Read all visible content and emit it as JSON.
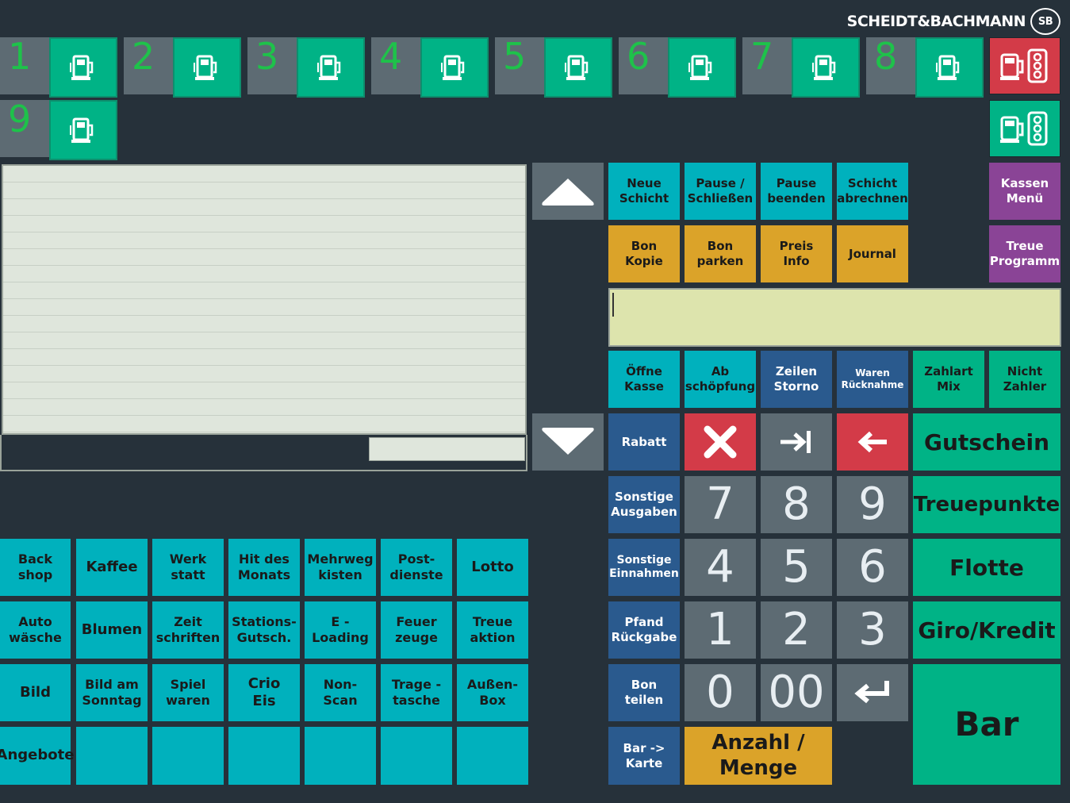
{
  "brand": {
    "name": "SCHEIDT&BACHMANN",
    "logo": "SB"
  },
  "pumps": [
    "1",
    "2",
    "3",
    "4",
    "5",
    "6",
    "7",
    "8",
    "9"
  ],
  "right_side": {
    "kassen_menu": "Kassen\nMenü",
    "treue_programm": "Treue\nProgramm"
  },
  "shift": {
    "neue_schicht": "Neue\nSchicht",
    "pause_schliessen": "Pause /\nSchließen",
    "pause_beenden": "Pause\nbeenden",
    "schicht_abrechnen": "Schicht\nabrechnen"
  },
  "receipt_ops": {
    "bon_kopie": "Bon\nKopie",
    "bon_parken": "Bon\nparken",
    "preis_info": "Preis\nInfo",
    "journal": "Journal"
  },
  "register": {
    "oeffne_kasse": "Öffne\nKasse",
    "abschoepfung": "Ab\nschöpfung",
    "zeilen_storno": "Zeilen\nStorno",
    "waren_ruecknahme": "Waren\nRücknahme",
    "zahlart_mix": "Zahlart\nMix",
    "nicht_zahler": "Nicht\nZahler",
    "rabatt": "Rabatt",
    "sonstige_ausgaben": "Sonstige\nAusgaben",
    "sonstige_einnahmen": "Sonstige\nEinnahmen",
    "pfand_rueckgabe": "Pfand\nRückgabe",
    "bon_teilen": "Bon\nteilen",
    "bar_karte": "Bar ->\nKarte",
    "anzahl_menge": "Anzahl /\nMenge"
  },
  "keypad": {
    "k7": "7",
    "k8": "8",
    "k9": "9",
    "k4": "4",
    "k5": "5",
    "k6": "6",
    "k1": "1",
    "k2": "2",
    "k3": "3",
    "k0": "0",
    "k00": "00"
  },
  "payments": {
    "gutschein": "Gutschein",
    "treuepunkte": "Treuepunkte",
    "flotte": "Flotte",
    "giro_kredit": "Giro/Kredit",
    "bar": "Bar"
  },
  "articles": [
    [
      "Back\nshop",
      "Kaffee",
      "Werk\nstatt",
      "Hit des\nMonats",
      "Mehrweg\nkisten",
      "Post-\ndienste",
      "Lotto"
    ],
    [
      "Auto\nwäsche",
      "Blumen",
      "Zeit\nschriften",
      "Stations-\nGutsch.",
      "E -\nLoading",
      "Feuer\nzeuge",
      "Treue\naktion"
    ],
    [
      "Bild",
      "Bild am\nSonntag",
      "Spiel\nwaren",
      "Crio\nEis",
      "Non-\nScan",
      "Trage -\ntasche",
      "Außen-\nBox"
    ],
    [
      "Angebote",
      "",
      "",
      "",
      "",
      "",
      ""
    ]
  ],
  "colors": {
    "background": "#26313a",
    "pump_green": "#00b386",
    "pump_number": "#1ec24a",
    "article_cyan": "#00b1bd",
    "orange": "#dba329",
    "blue": "#2a5a8e",
    "purple": "#8a4496",
    "red": "#d33b48",
    "grey": "#5d6b73",
    "input_bg": "#dde4ad"
  }
}
